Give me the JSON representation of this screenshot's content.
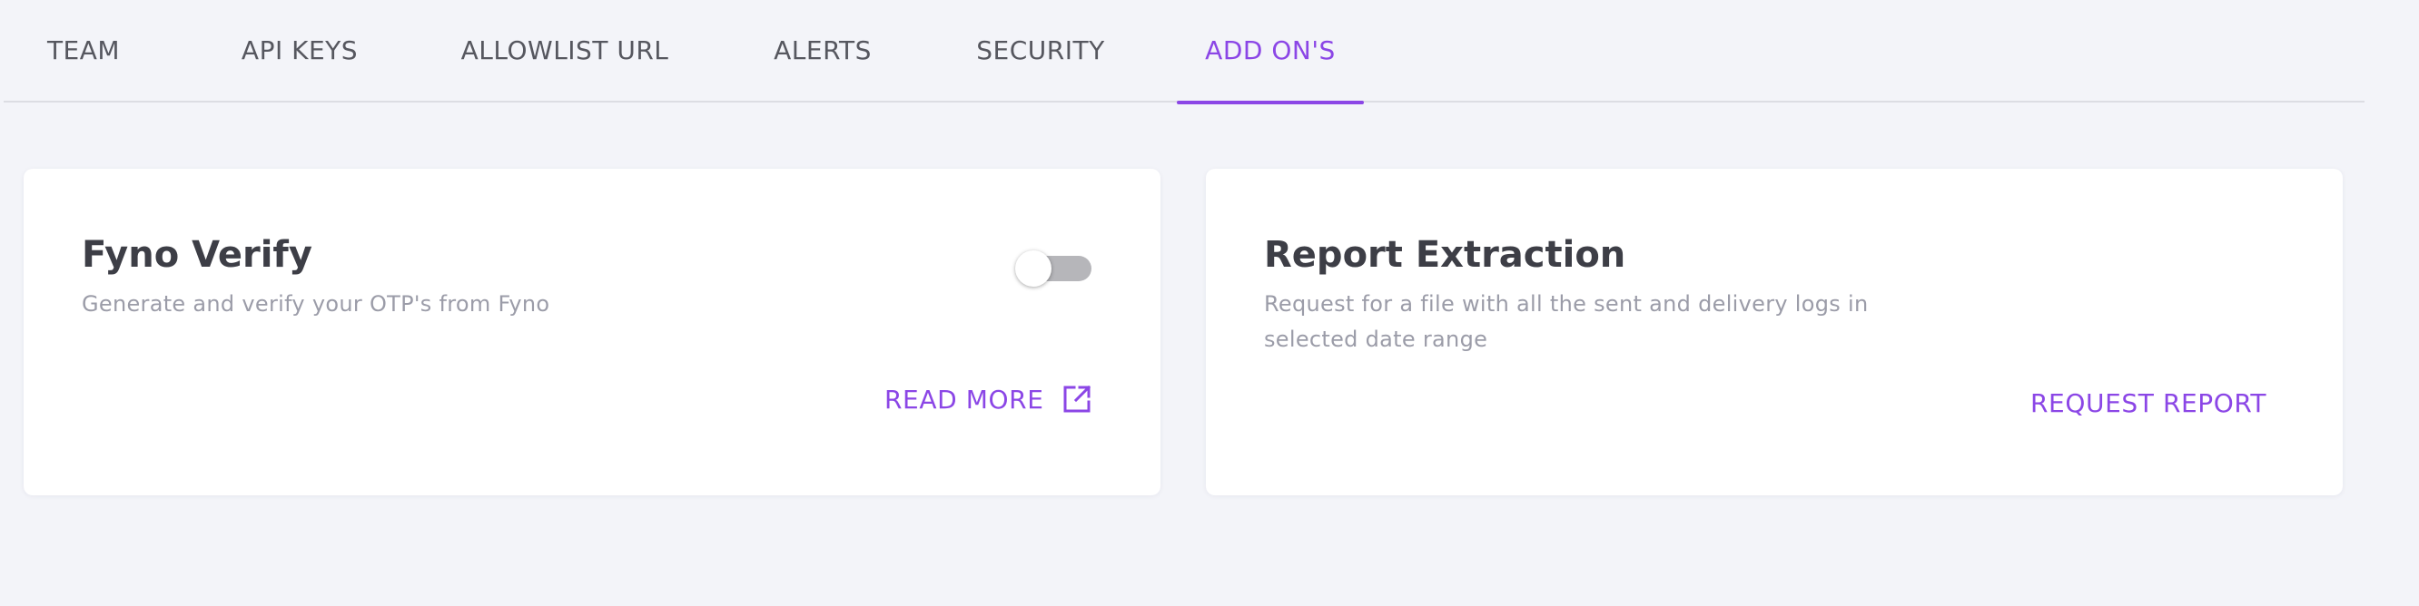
{
  "tabs": [
    {
      "label": "TEAM",
      "active": false
    },
    {
      "label": "API KEYS",
      "active": false
    },
    {
      "label": "ALLOWLIST URL",
      "active": false
    },
    {
      "label": "ALERTS",
      "active": false
    },
    {
      "label": "SECURITY",
      "active": false
    },
    {
      "label": "ADD ON'S",
      "active": true
    }
  ],
  "cards": {
    "verify": {
      "title": "Fyno Verify",
      "description": "Generate and verify your OTP's from Fyno",
      "toggle_on": false,
      "action_label": "READ MORE",
      "action_icon": "external-link-icon"
    },
    "report": {
      "title": "Report Extraction",
      "description": "Request for a file with all the sent and delivery logs in selected date range",
      "action_label": "REQUEST REPORT"
    }
  },
  "colors": {
    "accent": "#8b46e6",
    "background": "#f3f4f9",
    "card": "#ffffff",
    "tab_text": "#56575f",
    "title_text": "#3d3e46",
    "muted_text": "#9b9ca8",
    "toggle_off": "#b6b6ba"
  }
}
